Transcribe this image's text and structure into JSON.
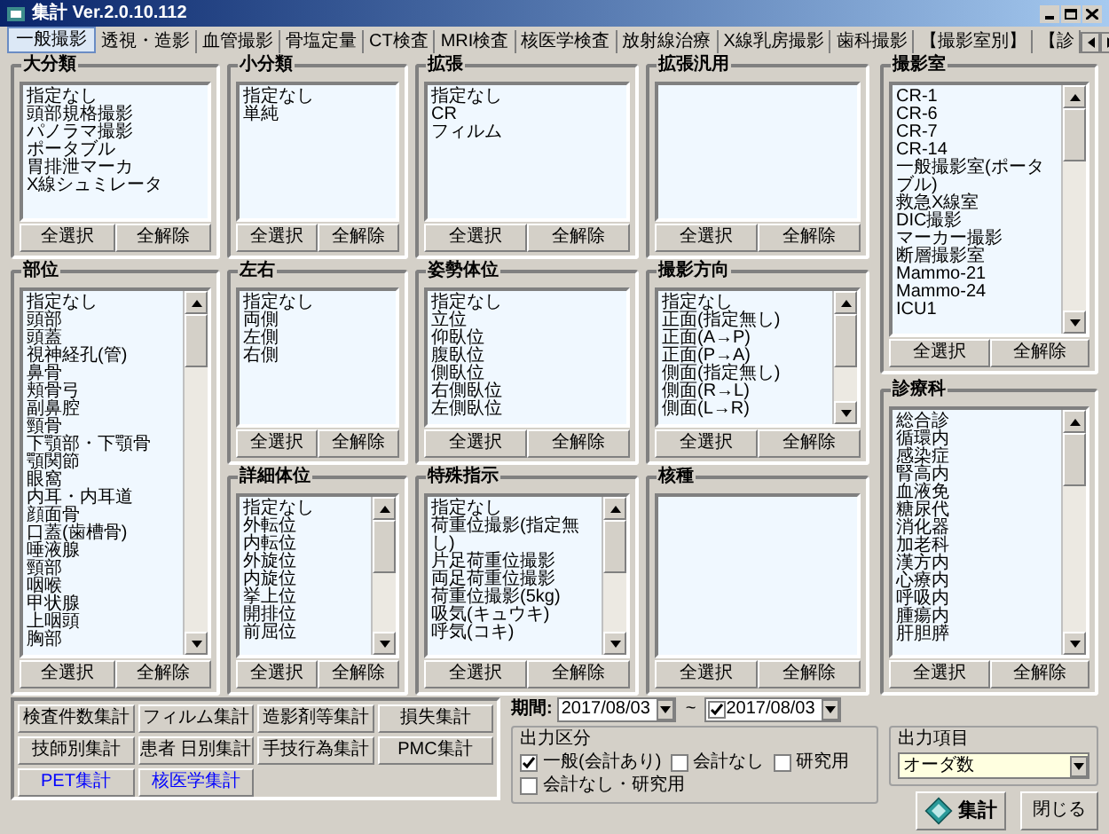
{
  "window": {
    "title": "集計 Ver.2.0.10.112"
  },
  "tabs": [
    {
      "label": "一般撮影",
      "selected": true
    },
    {
      "label": "透視・造影",
      "selected": false
    },
    {
      "label": "血管撮影",
      "selected": false
    },
    {
      "label": "骨塩定量",
      "selected": false
    },
    {
      "label": "CT検査",
      "selected": false
    },
    {
      "label": "MRI検査",
      "selected": false
    },
    {
      "label": "核医学検査",
      "selected": false
    },
    {
      "label": "放射線治療",
      "selected": false
    },
    {
      "label": "X線乳房撮影",
      "selected": false
    },
    {
      "label": "歯科撮影",
      "selected": false
    },
    {
      "label": "【撮影室別】",
      "selected": false
    },
    {
      "label": "【診",
      "selected": false
    }
  ],
  "panels": [
    {
      "title": "大分類",
      "scrollable": false,
      "items": [
        "指定なし",
        "頭部規格撮影",
        "パノラマ撮影",
        "ポータブル",
        "胃排泄マーカ",
        "X線シュミレータ"
      ],
      "buttons": [
        "全選択",
        "全解除"
      ]
    },
    {
      "title": "小分類",
      "scrollable": false,
      "items": [
        "指定なし",
        "単純"
      ],
      "buttons": [
        "全選択",
        "全解除"
      ]
    },
    {
      "title": "拡張",
      "scrollable": false,
      "items": [
        "指定なし",
        "CR",
        "フィルム"
      ],
      "buttons": [
        "全選択",
        "全解除"
      ]
    },
    {
      "title": "拡張汎用",
      "scrollable": false,
      "buttons": [
        "全選択",
        "全解除"
      ]
    },
    {
      "title": "撮影室",
      "scrollable": true,
      "items": [
        "CR-1",
        "CR-6",
        "CR-7",
        "CR-14",
        "一般撮影室(ポータブル)",
        "救急X線室",
        "DIC撮影",
        "マーカー撮影",
        "断層撮影室",
        "Mammo-21",
        "Mammo-24",
        "ICU1"
      ],
      "buttons": [
        "全選択",
        "全解除"
      ]
    },
    {
      "title": "部位",
      "scrollable": true,
      "items": [
        "指定なし",
        "頭部",
        "頭蓋",
        "視神経孔(管)",
        "鼻骨",
        "頬骨弓",
        "副鼻腔",
        "頸骨",
        "下顎部・下顎骨",
        "顎関節",
        "眼窩",
        "内耳・内耳道",
        "顔面骨",
        "口蓋(歯槽骨)",
        "唾液腺",
        "頸部",
        "咽喉",
        "甲状腺",
        "上咽頭",
        "胸部"
      ],
      "buttons": [
        "全選択",
        "全解除"
      ]
    },
    {
      "title": "左右",
      "scrollable": false,
      "items": [
        "指定なし",
        "両側",
        "左側",
        "右側"
      ],
      "buttons": [
        "全選択",
        "全解除"
      ]
    },
    {
      "title": "姿勢体位",
      "scrollable": false,
      "items": [
        "指定なし",
        "立位",
        "仰臥位",
        "腹臥位",
        "側臥位",
        "右側臥位",
        "左側臥位"
      ],
      "buttons": [
        "全選択",
        "全解除"
      ]
    },
    {
      "title": "撮影方向",
      "scrollable": true,
      "items": [
        "指定なし",
        "正面(指定無し)",
        "正面(A→P)",
        "正面(P→A)",
        "側面(指定無し)",
        "側面(R→L)",
        "側面(L→R)"
      ],
      "buttons": [
        "全選択",
        "全解除"
      ]
    },
    {
      "title": "詳細体位",
      "scrollable": true,
      "items": [
        "指定なし",
        "外転位",
        "内転位",
        "外旋位",
        "内旋位",
        "挙上位",
        "開排位",
        "前屈位"
      ],
      "buttons": [
        "全選択",
        "全解除"
      ]
    },
    {
      "title": "特殊指示",
      "scrollable": true,
      "items": [
        "指定なし",
        "荷重位撮影(指定無し)",
        "片足荷重位撮影",
        "両足荷重位撮影",
        "荷重位撮影(5kg)",
        "吸気(キュウキ)",
        "呼気(コキ)"
      ],
      "buttons": [
        "全選択",
        "全解除"
      ]
    },
    {
      "title": "核種",
      "scrollable": false,
      "buttons": [
        "全選択",
        "全解除"
      ]
    },
    {
      "title": "診療科",
      "scrollable": true,
      "items": [
        "総合診",
        "循環内",
        "感染症",
        "腎高内",
        "血液免",
        "糖尿代",
        "消化器",
        "加老科",
        "漢方内",
        "心療内",
        "呼吸内",
        "腫瘍内",
        "肝胆膵"
      ],
      "buttons": [
        "全選択",
        "全解除"
      ]
    }
  ],
  "report_buttons": [
    {
      "label": "検査件数集計",
      "color": "#000000"
    },
    {
      "label": "フィルム集計",
      "color": "#000000"
    },
    {
      "label": "造影剤等集計",
      "color": "#000000"
    },
    {
      "label": "損失集計",
      "color": "#000000"
    },
    {
      "label": "技師別集計",
      "color": "#000000"
    },
    {
      "label": "患者 日別集計",
      "color": "#000000"
    },
    {
      "label": "手技行為集計",
      "color": "#000000"
    },
    {
      "label": "PMC集計",
      "color": "#000000"
    },
    {
      "label": "PET集計",
      "color": "#0000ff"
    },
    {
      "label": "核医学集計",
      "color": "#0000ff"
    }
  ],
  "period": {
    "label": "期間:",
    "from": "2017/08/03",
    "separator": "~",
    "to": "2017/08/03",
    "to_checked": true
  },
  "output_category": {
    "title": "出力区分",
    "options": [
      {
        "label": "一般(会計あり)",
        "checked": true
      },
      {
        "label": "会計なし",
        "checked": false
      },
      {
        "label": "研究用",
        "checked": false
      },
      {
        "label": "会計なし・研究用",
        "checked": false
      }
    ]
  },
  "output_item": {
    "title": "出力項目",
    "value": "オーダ数"
  },
  "actions": [
    {
      "label": "集計",
      "kind": "run"
    },
    {
      "label": "閉じる",
      "kind": "close"
    }
  ]
}
